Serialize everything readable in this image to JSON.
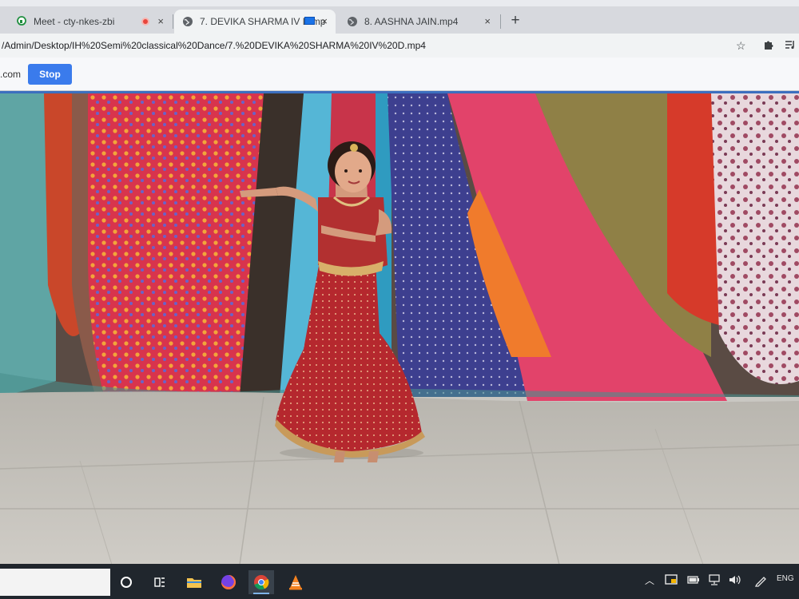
{
  "browser": {
    "tabs": [
      {
        "title": "Meet - cty-nkes-zbi",
        "icon": "google-meet-icon",
        "recording_indicator": true
      },
      {
        "title": "7. DEVIKA SHARMA IV D.mp",
        "icon": "globe-icon",
        "sharing_indicator": true,
        "active": true
      },
      {
        "title": "8. AASHNA JAIN.mp4",
        "icon": "globe-icon"
      }
    ],
    "new_tab_symbol": "+",
    "close_symbol": "×",
    "address": "/Admin/Desktop/IH%20Semi%20classical%20Dance/7.%20DEVIKA%20SHARMA%20IV%20D.mp4",
    "toolbar_icons": [
      "star-icon",
      "extensions-icon",
      "media-control-icon"
    ]
  },
  "share_bar": {
    "domain_fragment": ".com",
    "stop_label": "Stop"
  },
  "video": {
    "content": "video-frame"
  },
  "taskbar": {
    "pinned": [
      "cortana-icon",
      "task-view-icon",
      "file-explorer-icon",
      "firefox-icon",
      "chrome-icon",
      "vlc-icon"
    ],
    "active_app": "chrome-icon",
    "tray_icons": [
      "chevron-up-icon",
      "meet-present-icon",
      "battery-icon",
      "network-icon",
      "volume-icon",
      "pen-icon"
    ],
    "language": "ENG"
  },
  "colors": {
    "stop_button": "#3a7bec",
    "taskbar": "#20262d",
    "share_border": "#3c6fbf",
    "recording_red": "#e8453c"
  }
}
